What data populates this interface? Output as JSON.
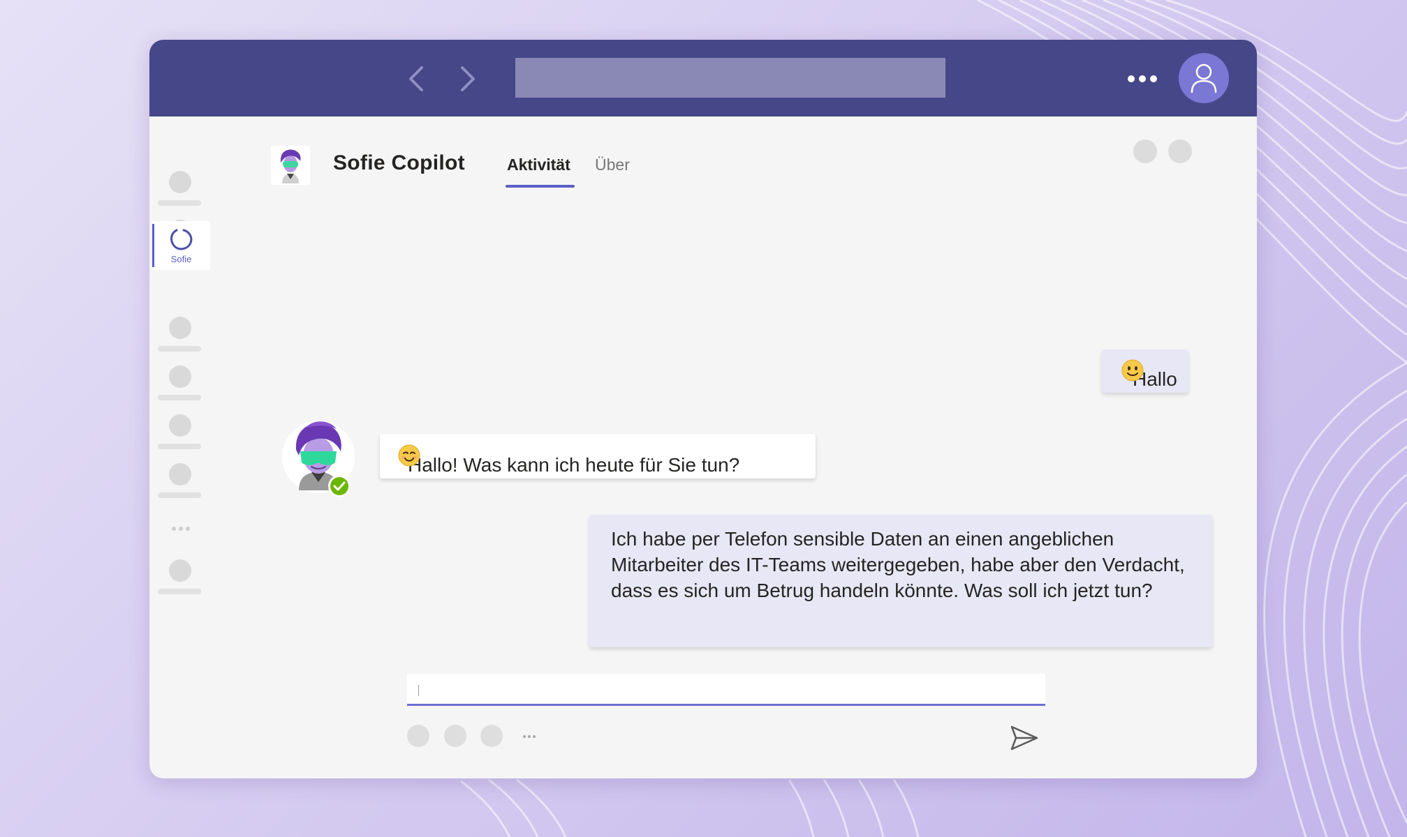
{
  "bot": {
    "name": "Sofie Copilot",
    "rail_label": "Sofie",
    "status": "available"
  },
  "tabs": [
    {
      "label": "Aktivität",
      "active": true
    },
    {
      "label": "Über",
      "active": false
    }
  ],
  "messages": [
    {
      "sender": "user",
      "text": "Hallo",
      "emoji": "slightly-smiling-face"
    },
    {
      "sender": "bot",
      "text": "Hallo! Was kann ich heute für Sie tun?",
      "emoji": "smiling-face"
    },
    {
      "sender": "user",
      "text": "Ich habe per Telefon sensible Daten an einen angeblichen Mitarbeiter des IT-Teams weitergegeben, habe aber den Verdacht, dass es sich um Betrug handeln könnte. Was soll ich jetzt tun?"
    }
  ],
  "compose": {
    "value": ""
  },
  "icons": {
    "back": "chevron-left-icon",
    "forward": "chevron-right-icon",
    "more": "ellipsis-icon",
    "user": "person-icon",
    "send": "send-icon",
    "status": "check-circle-icon"
  },
  "colors": {
    "titlebar": "#454788",
    "accent": "#5b5fc7",
    "user_bubble": "#e8e7f5",
    "bot_bubble": "#ffffff",
    "status_green": "#6bb700"
  }
}
